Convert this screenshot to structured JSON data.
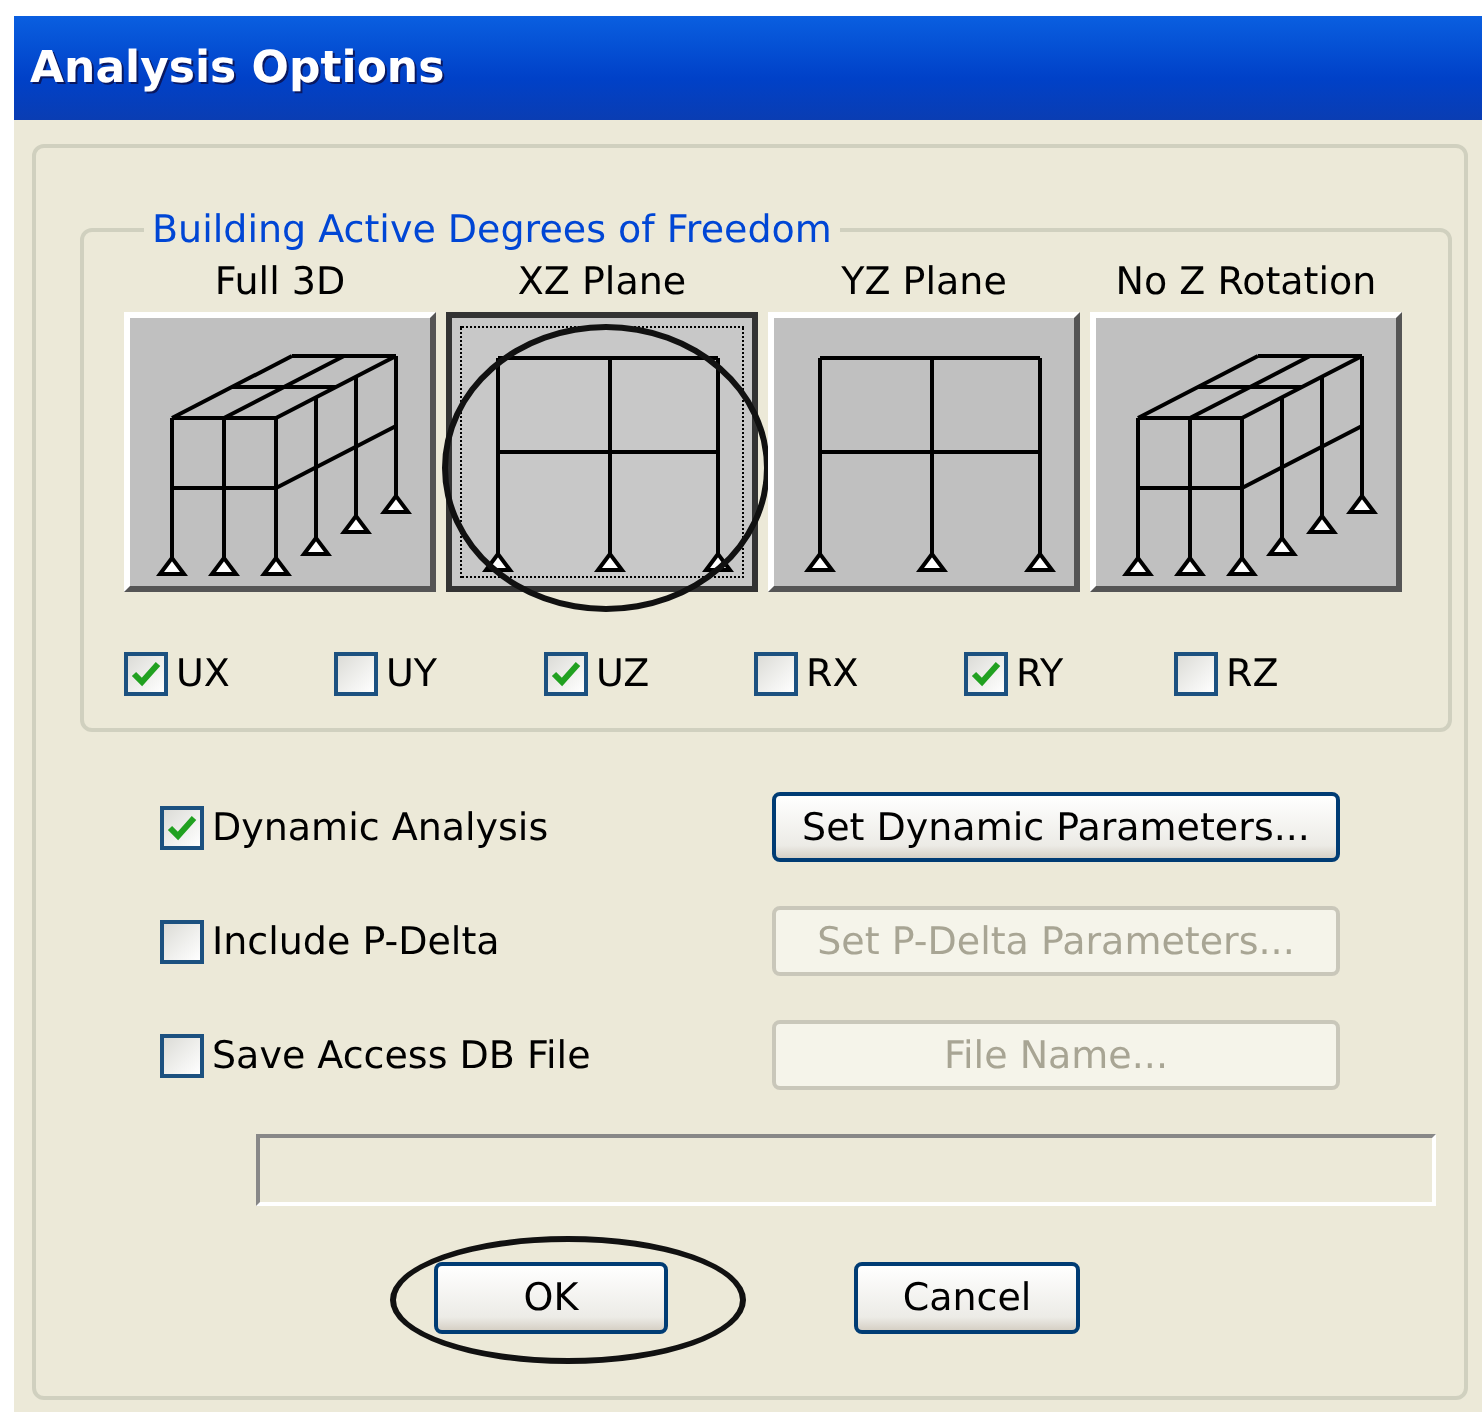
{
  "window": {
    "title": "Analysis Options"
  },
  "dof_group": {
    "title": "Building Active Degrees of Freedom",
    "presets": [
      {
        "label": "Full 3D",
        "kind": "spatial",
        "selected": false,
        "circled": false
      },
      {
        "label": "XZ Plane",
        "kind": "plane",
        "selected": true,
        "circled": true
      },
      {
        "label": "YZ Plane",
        "kind": "plane",
        "selected": false,
        "circled": false
      },
      {
        "label": "No Z Rotation",
        "kind": "spatial",
        "selected": false,
        "circled": false
      }
    ],
    "dofs": [
      {
        "label": "UX",
        "checked": true
      },
      {
        "label": "UY",
        "checked": false
      },
      {
        "label": "UZ",
        "checked": true
      },
      {
        "label": "RX",
        "checked": false
      },
      {
        "label": "RY",
        "checked": true
      },
      {
        "label": "RZ",
        "checked": false
      }
    ]
  },
  "options": [
    {
      "label": "Dynamic Analysis",
      "checked": true,
      "button": {
        "label": "Set Dynamic Parameters...",
        "disabled": false
      }
    },
    {
      "label": "Include P-Delta",
      "checked": false,
      "button": {
        "label": "Set P-Delta Parameters...",
        "disabled": true
      }
    },
    {
      "label": "Save Access DB File",
      "checked": false,
      "button": {
        "label": "File Name...",
        "disabled": true
      }
    }
  ],
  "buttons": [
    {
      "label": "OK",
      "circled": true
    },
    {
      "label": "Cancel",
      "circled": false
    }
  ]
}
